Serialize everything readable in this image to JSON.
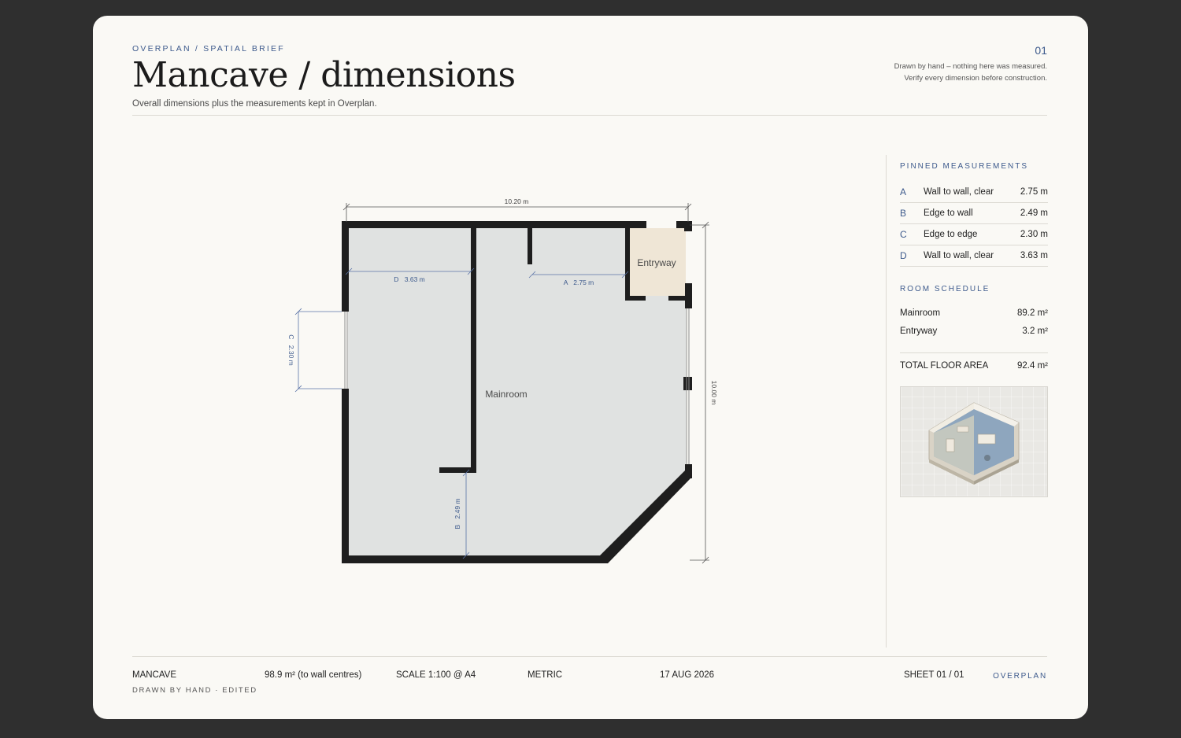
{
  "header": {
    "kicker": "OVERPLAN / SPATIAL BRIEF",
    "title": "Mancave / dimensions",
    "subtitle": "Overall dimensions plus the measurements kept in Overplan.",
    "sheet_number": "01",
    "note_line1": "Drawn by hand – nothing here was measured.",
    "note_line2": "Verify every dimension before construction."
  },
  "plan": {
    "rooms": [
      {
        "name": "Mainroom"
      },
      {
        "name": "Entryway"
      }
    ],
    "overall_width": "10.20 m",
    "overall_depth": "10.00 m",
    "dimensions": [
      {
        "letter": "A",
        "value": "2.75 m"
      },
      {
        "letter": "B",
        "value": "2.49 m"
      },
      {
        "letter": "C",
        "value": "2.30 m"
      },
      {
        "letter": "D",
        "value": "3.63 m"
      }
    ]
  },
  "sidebar": {
    "pinned_heading": "PINNED MEASUREMENTS",
    "measurements": [
      {
        "letter": "A",
        "label": "Wall to wall, clear",
        "value": "2.75 m"
      },
      {
        "letter": "B",
        "label": "Edge to wall",
        "value": "2.49 m"
      },
      {
        "letter": "C",
        "label": "Edge to edge",
        "value": "2.30 m"
      },
      {
        "letter": "D",
        "label": "Wall to wall, clear",
        "value": "3.63 m"
      }
    ],
    "schedule_heading": "ROOM SCHEDULE",
    "schedule": [
      {
        "room": "Mainroom",
        "area": "89.2 m²"
      },
      {
        "room": "Entryway",
        "area": "3.2 m²"
      }
    ],
    "total_label": "TOTAL FLOOR AREA",
    "total_value": "92.4 m²"
  },
  "footer": {
    "project": "MANCAVE",
    "project_sub": "DRAWN BY HAND · EDITED",
    "area": "98.9 m² (to wall centres)",
    "scale": "SCALE 1:100 @ A4",
    "units": "METRIC",
    "date": "17 AUG 2026",
    "sheet": "SHEET 01 / 01",
    "brand": "OVERPLAN"
  },
  "colors": {
    "accent": "#3d5a8c",
    "wall": "#1e1e1e",
    "floor": "#e0e2e1",
    "entry_floor": "#efe6d6"
  }
}
